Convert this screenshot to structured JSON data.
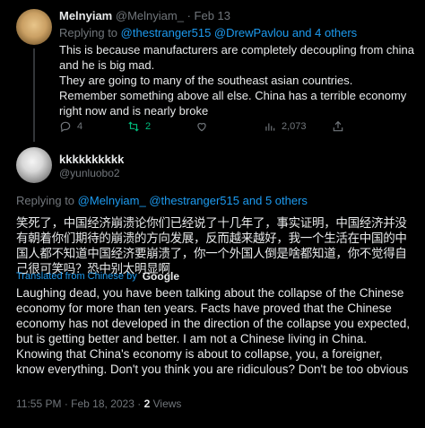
{
  "reply": {
    "name": "Melnyiam",
    "handle": "@Melnyiam_",
    "separator": "·",
    "date": "Feb 13",
    "replying_prefix": "Replying to",
    "replying_links": "@thestranger515 @DrewPavlou",
    "replying_and": "and",
    "replying_others": "4 others",
    "text_lines": [
      "This is because manufacturers are completely decoupling from china and he is big mad.",
      " They are going to many of the southeast asian countries.",
      " Remember something above all else. China has a terrible economy right now and is nearly broke"
    ],
    "actions": {
      "replies": "4",
      "retweets": "2",
      "likes": "",
      "views": "2,073"
    },
    "icons": [
      "reply-icon",
      "retweet-icon",
      "like-icon",
      "views-icon",
      "share-icon"
    ]
  },
  "focus": {
    "name": "kkkkkkkkkk",
    "handle": "@yunluobo2",
    "replying_prefix": "Replying to",
    "replying_links": "@Melnyiam_ @thestranger515",
    "replying_and": "and",
    "replying_others": "5 others",
    "original_text": "笑死了，中国经济崩溃论你们已经说了十几年了，事实证明，中国经济并没有朝着你们期待的崩溃的方向发展，反而越来越好，我一个生活在中国的中国人都不知道中国经济要崩溃了，你一个外国人倒是啥都知道，你不觉得自己很可笑吗？恐中别太明显啊",
    "translated_label": "Translated from Chinese by",
    "translator": "Google",
    "translation": "Laughing dead, you have been talking about the collapse of the Chinese economy for more than ten years. Facts have proved that the Chinese economy has not developed in the direction of the collapse you expected, but is getting better and better. I am not a Chinese living in China. Knowing that China's economy is about to collapse, you, a foreigner, know everything. Don't you think you are ridiculous? Don't be too obvious",
    "time": "11:55 PM",
    "date": "Feb 18, 2023",
    "separator": "·",
    "views_count": "2",
    "views_label": "Views"
  },
  "colors": {
    "background": "#000000",
    "text": "#e7e9ea",
    "muted": "#71767b",
    "link": "#1d9bf0",
    "retweet": "#00ba7c"
  }
}
